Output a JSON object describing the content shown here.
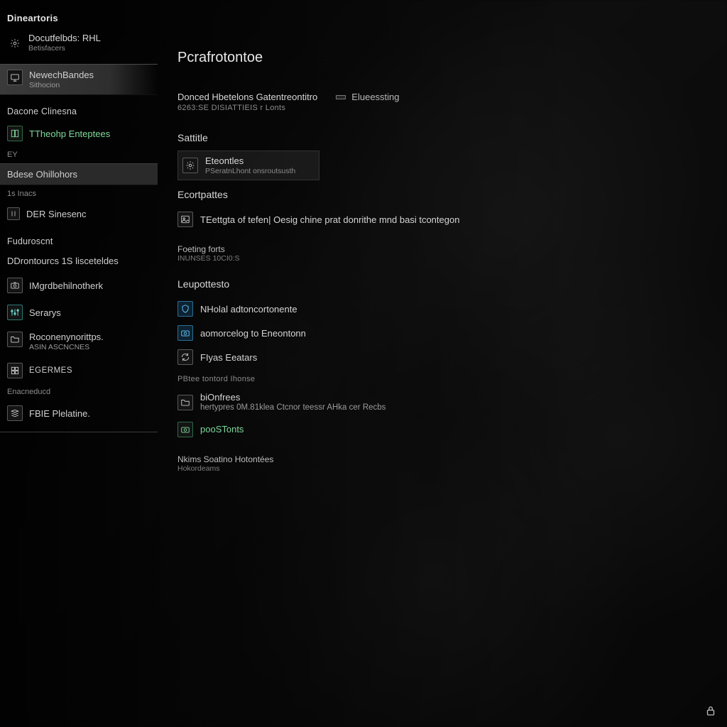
{
  "app_title": "Dineartoris",
  "profile": {
    "name": "Docutfelbds: RHL",
    "sub": "Betisfacers"
  },
  "sidebar": {
    "item_active": {
      "label": "NewechBandes",
      "sub": "Sithocion"
    },
    "section1": "Dacone Clinesna",
    "item_theop": "TTheohp Enteptees",
    "minor_ey": "EY",
    "item_bdese": "Bdese Ohillohors",
    "minor_inacs": "1s Inacs",
    "item_der": "DER Sinesenc",
    "section_fud": "Fuduroscnt",
    "item_dontout": "DDrontourcs 1S lisceteldes",
    "item_mgrdbeh": "IMgrdbehilnotherk",
    "item_serarys": "Serarys",
    "item_roconer": "Roconenynorittps.",
    "minor_ascnci": "ASIN ASCNCNES",
    "item_egermes": "EGERMES",
    "minor_enacned": "Enacneducd",
    "item_fbie": "FBIE Plelatine."
  },
  "main": {
    "title": "Pcrafrotontoe",
    "hero": {
      "title": "Donced Hbetelons  Gatentreontitro",
      "sub": "6263:SE DISIATTIEIS r Lonts"
    },
    "slider_label": "Elueessting",
    "sec_sattitle": "Sattitle",
    "tile_etontles": {
      "label": "Eteontles",
      "sub": "PSeratnLhont onsroutsusth"
    },
    "sec_ecortpattes": "Ecortpattes",
    "ecort_line": "TEettgta of tefen| Oesig chine prat donrithe mnd basi tcontegon",
    "sec_foetingforts": {
      "title": "Foeting forts",
      "sub": "INUNSES  10CI0:S"
    },
    "sec_leupottesto": "Leupottesto",
    "link_nholal": "NHolal adtoncortonente",
    "link_aomorcelog": "aomorcelog to Eneontonn",
    "link_flyas": "FIyas Eeatars",
    "subhead_pb": "PBtee tontord Ihonse",
    "folder_line": {
      "title": "biOnfrees",
      "sub": "hertypres  0M.81klea Ctcnor teessr AHka cer Recbs"
    },
    "link_poostonts": "pooSTonts",
    "sec_nkims": {
      "title": "Nkims Soatino Hotontées",
      "sub": "Hokordeams"
    }
  }
}
